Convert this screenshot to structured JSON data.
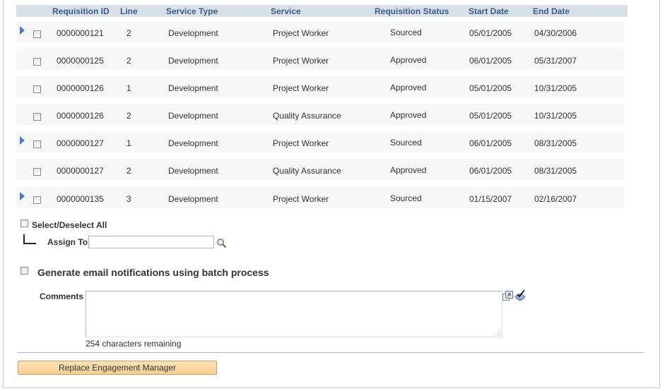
{
  "grid": {
    "columns": [
      "Requisition ID",
      "Line",
      "Service Type",
      "Service",
      "Requisition Status",
      "Start Date",
      "End Date"
    ],
    "rows": [
      {
        "expandable": true,
        "selected": false,
        "requisition_id": "0000000121",
        "line": "2",
        "service_type": "Development",
        "service": "Project Worker",
        "status": "Sourced",
        "start_date": "05/01/2005",
        "end_date": "04/30/2006"
      },
      {
        "expandable": false,
        "selected": false,
        "requisition_id": "0000000125",
        "line": "2",
        "service_type": "Development",
        "service": "Project Worker",
        "status": "Approved",
        "start_date": "06/01/2005",
        "end_date": "05/31/2007"
      },
      {
        "expandable": false,
        "selected": false,
        "requisition_id": "0000000126",
        "line": "1",
        "service_type": "Development",
        "service": "Project Worker",
        "status": "Approved",
        "start_date": "05/01/2005",
        "end_date": "10/31/2005"
      },
      {
        "expandable": false,
        "selected": false,
        "requisition_id": "0000000126",
        "line": "2",
        "service_type": "Development",
        "service": "Quality Assurance",
        "status": "Approved",
        "start_date": "05/01/2005",
        "end_date": "10/31/2005"
      },
      {
        "expandable": true,
        "selected": false,
        "requisition_id": "0000000127",
        "line": "1",
        "service_type": "Development",
        "service": "Project Worker",
        "status": "Sourced",
        "start_date": "06/01/2005",
        "end_date": "08/31/2005"
      },
      {
        "expandable": false,
        "selected": false,
        "requisition_id": "0000000127",
        "line": "2",
        "service_type": "Development",
        "service": "Quality Assurance",
        "status": "Approved",
        "start_date": "06/01/2005",
        "end_date": "08/31/2005"
      },
      {
        "expandable": true,
        "selected": false,
        "requisition_id": "0000000135",
        "line": "3",
        "service_type": "Development",
        "service": "Project Worker",
        "status": "Sourced",
        "start_date": "01/15/2007",
        "end_date": "02/16/2007"
      }
    ]
  },
  "select_all": {
    "label": "Select/Deselect All",
    "checked": false
  },
  "assign_to": {
    "label": "Assign To",
    "value": ""
  },
  "email_batch": {
    "label": "Generate email notifications using batch process",
    "checked": false
  },
  "comments": {
    "label": "Comments",
    "value": "",
    "remaining_text": "254 characters remaining"
  },
  "replace_button": {
    "label": "Replace Engagement Manager"
  },
  "colors": {
    "header_bg": "#d8e0e8",
    "header_text": "#3b5b8c",
    "row_bg": "#f7f7f7",
    "button_bg": "#f8cf93",
    "expander": "#4a78c0"
  }
}
